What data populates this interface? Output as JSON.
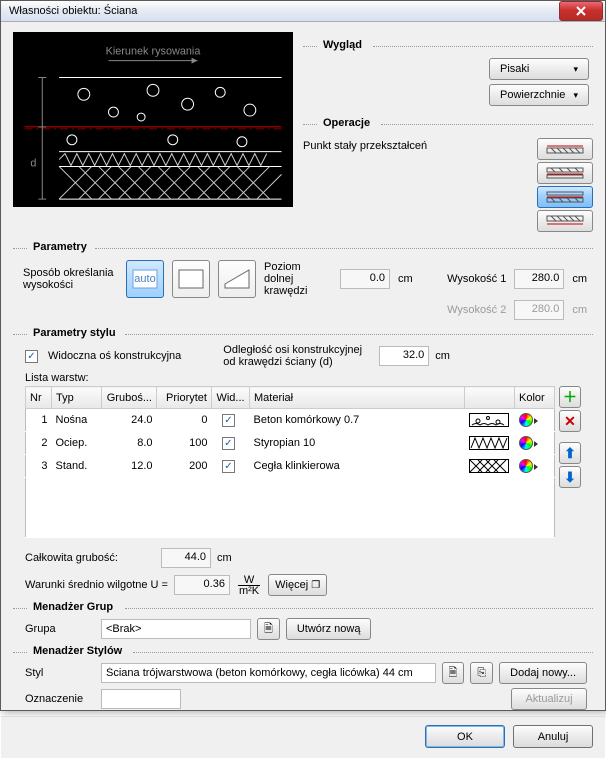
{
  "window": {
    "title": "Własności obiektu: Ściana"
  },
  "preview": {
    "caption": "Kierunek rysowania",
    "d_label": "d"
  },
  "wyglad": {
    "title": "Wygląd",
    "pisaki": "Pisaki",
    "powierzchnie": "Powierzchnie"
  },
  "operacje": {
    "title": "Operacje",
    "punkt_label": "Punkt stały przekształceń"
  },
  "parametry": {
    "title": "Parametry",
    "sposob_label": "Sposób określania wysokości",
    "poziom_label": "Poziom dolnej krawędzi",
    "poziom_val": "0.0",
    "cm": "cm",
    "wys1_label": "Wysokość 1",
    "wys1_val": "280.0",
    "wys2_label": "Wysokość 2",
    "wys2_val": "280.0"
  },
  "stylu": {
    "title": "Parametry stylu",
    "widoczna_label": "Widoczna oś konstrukcyjna",
    "widoczna_checked": true,
    "odleglosc_label": "Odległość osi konstrukcyjnej od krawędzi ściany (d)",
    "odleglosc_val": "32.0",
    "cm": "cm",
    "lista_label": "Lista warstw:",
    "cols": {
      "nr": "Nr",
      "typ": "Typ",
      "grubos": "Gruboś...",
      "priorytet": "Priorytet",
      "wid": "Wid...",
      "material": "Materiał",
      "kolor": "Kolor"
    },
    "rows": [
      {
        "nr": "1",
        "typ": "Nośna",
        "g": "24.0",
        "p": "0",
        "wid": true,
        "mat": "Beton komórkowy 0.7"
      },
      {
        "nr": "2",
        "typ": "Ociep.",
        "g": "8.0",
        "p": "100",
        "wid": true,
        "mat": "Styropian 10"
      },
      {
        "nr": "3",
        "typ": "Stand.",
        "g": "12.0",
        "p": "200",
        "wid": true,
        "mat": "Cegła klinkierowa"
      }
    ],
    "calk_label": "Całkowita grubość:",
    "calk_val": "44.0",
    "warunki_label": "Warunki średnio wilgotne U =",
    "warunki_val": "0.36",
    "unit_top": "W",
    "unit_bot": "m²K",
    "wiecej": "Więcej"
  },
  "grupy": {
    "title": "Menadżer Grup",
    "grupa_label": "Grupa",
    "grupa_val": "<Brak>",
    "utworz": "Utwórz nową"
  },
  "style": {
    "title": "Menadżer Stylów",
    "styl_label": "Styl",
    "styl_val": "Ściana trójwarstwowa (beton komórkowy, cegła licówka) 44 cm",
    "dodaj": "Dodaj nowy...",
    "ozn_label": "Oznaczenie",
    "ozn_val": "",
    "aktualizuj": "Aktualizuj"
  },
  "buttons": {
    "ok": "OK",
    "anuluj": "Anuluj"
  }
}
